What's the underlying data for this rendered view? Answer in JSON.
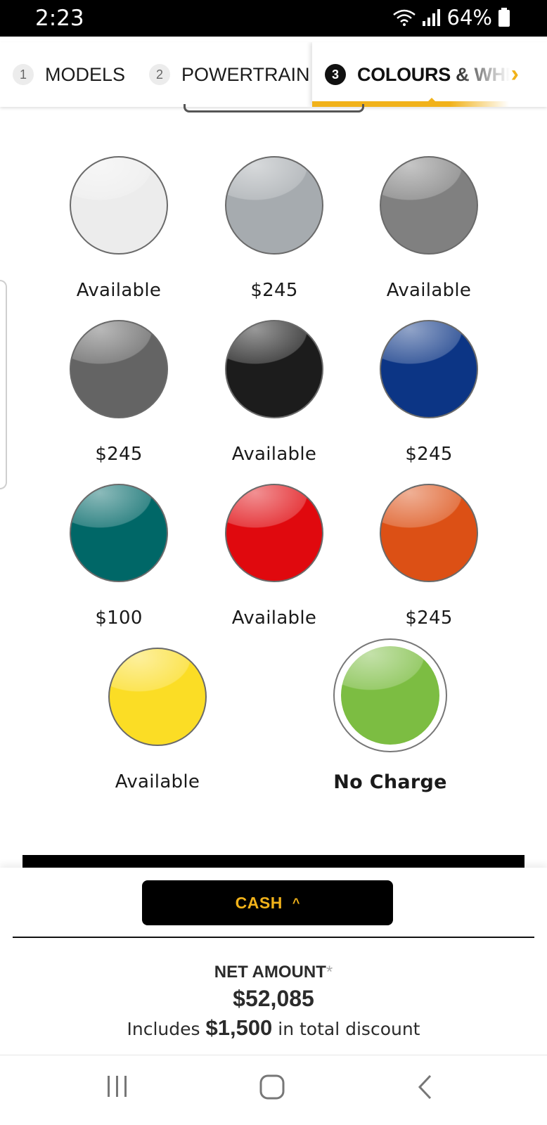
{
  "status_bar": {
    "time": "2:23",
    "battery": "64%"
  },
  "steps": [
    {
      "num": "1",
      "label": "MODELS"
    },
    {
      "num": "2",
      "label": "POWERTRAIN"
    },
    {
      "num": "3",
      "label": "COLOURS & WHE"
    }
  ],
  "swatches": [
    {
      "price": "Available",
      "color": "#ececec"
    },
    {
      "price": "$245",
      "color": "#a6abaf"
    },
    {
      "price": "Available",
      "color": "#808080"
    },
    {
      "price": "$245",
      "color": "#646464"
    },
    {
      "price": "Available",
      "color": "#1c1c1c"
    },
    {
      "price": "$245",
      "color": "#0c3585"
    },
    {
      "price": "$100",
      "color": "#006767"
    },
    {
      "price": "Available",
      "color": "#e0090e"
    },
    {
      "price": "$245",
      "color": "#dc5015"
    },
    {
      "price": "Available",
      "color": "#fbdd25"
    },
    {
      "price": "No Charge",
      "color": "#7cbd42",
      "selected": true
    }
  ],
  "summary": {
    "payment_button": "CASH",
    "net_label": "NET AMOUNT",
    "net_asterisk": "*",
    "net_amount": "$52,085",
    "discount_prefix": "Includes",
    "discount_amount": "$1,500",
    "discount_suffix": "in total discount"
  },
  "colors": {
    "accent": "#f1b21a"
  },
  "nav_icons": [
    "recents-icon",
    "home-icon",
    "back-icon"
  ]
}
